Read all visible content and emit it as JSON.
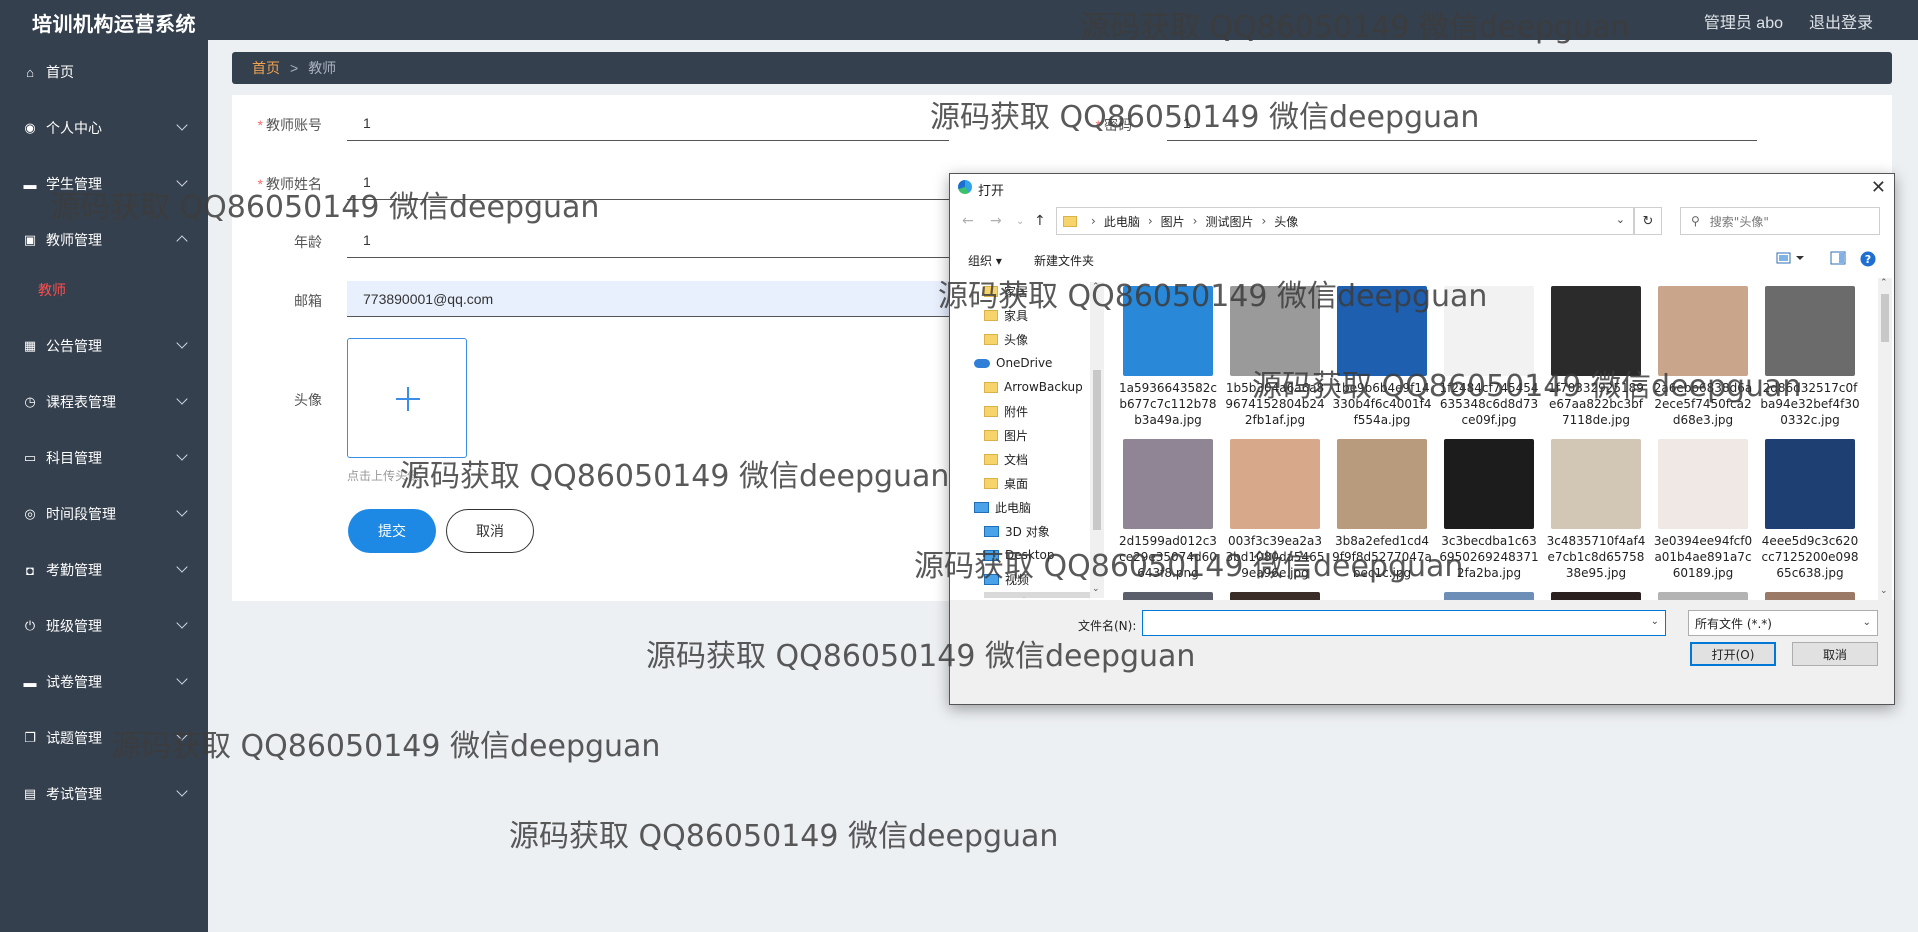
{
  "app": {
    "title": "培训机构运营系统",
    "user": "管理员 abo",
    "logout": "退出登录"
  },
  "sidebar": {
    "items": [
      {
        "label": "首页",
        "icon": "home-icon"
      },
      {
        "label": "个人中心",
        "icon": "user-icon"
      },
      {
        "label": "学生管理",
        "icon": "chat-icon"
      },
      {
        "label": "教师管理",
        "icon": "chart-icon",
        "expanded": true
      },
      {
        "label": "公告管理",
        "icon": "grid-icon"
      },
      {
        "label": "课程表管理",
        "icon": "clock-icon"
      },
      {
        "label": "科目管理",
        "icon": "monitor-icon"
      },
      {
        "label": "时间段管理",
        "icon": "target-icon"
      },
      {
        "label": "考勤管理",
        "icon": "message-icon"
      },
      {
        "label": "班级管理",
        "icon": "power-icon"
      },
      {
        "label": "试卷管理",
        "icon": "chat-icon"
      },
      {
        "label": "试题管理",
        "icon": "copy-icon"
      },
      {
        "label": "考试管理",
        "icon": "card-icon"
      }
    ],
    "submenu": {
      "label": "教师",
      "color": "#ff4d4f"
    }
  },
  "breadcrumb": {
    "home": "首页",
    "separator": ">",
    "current": "教师"
  },
  "form": {
    "account_label": "教师账号",
    "account_value": "1",
    "password_label": "密码",
    "password_value": "1",
    "name_label": "教师姓名",
    "name_value": "1",
    "age_label": "年龄",
    "age_value": "1",
    "email_label": "邮箱",
    "email_value": "773890001@qq.com",
    "avatar_label": "头像",
    "upload_hint": "点击上传头像",
    "submit": "提交",
    "cancel": "取消"
  },
  "watermark": "源码获取 QQ86050149 微信deepguan",
  "dialog": {
    "title": "打开",
    "path": [
      "此电脑",
      "图片",
      "测试图片",
      "头像"
    ],
    "search_placeholder": "搜索\"头像\"",
    "organize": "组织 ▾",
    "new_folder": "新建文件夹",
    "nav": [
      {
        "label": "家居",
        "type": "folder"
      },
      {
        "label": "家具",
        "type": "folder"
      },
      {
        "label": "头像",
        "type": "folder"
      },
      {
        "label": "OneDrive",
        "type": "cloud"
      },
      {
        "label": "ArrowBackup",
        "type": "folder"
      },
      {
        "label": "附件",
        "type": "folder"
      },
      {
        "label": "图片",
        "type": "folder"
      },
      {
        "label": "文档",
        "type": "folder"
      },
      {
        "label": "桌面",
        "type": "folder"
      },
      {
        "label": "此电脑",
        "type": "pc"
      },
      {
        "label": "3D 对象",
        "type": "pc"
      },
      {
        "label": "Desktop",
        "type": "pc"
      },
      {
        "label": "视频",
        "type": "pc"
      },
      {
        "label": "图片",
        "type": "pc",
        "selected": true
      }
    ],
    "files": [
      {
        "name": "1a5936643582cb677c7c112b78b3a49a.jpg",
        "color": "#2a88d8"
      },
      {
        "name": "1b5b304a6a6a89674152804b242fb1af.jpg",
        "color": "#9a9a9a"
      },
      {
        "name": "1be9b6b4e9f14330b4f6c4001f4f554a.jpg",
        "color": "#1f5fb0"
      },
      {
        "name": "1f2484cf745454635348c6d8d73ce09f.jpg",
        "color": "#f2f2f2"
      },
      {
        "name": "1f70332925189e67aa822bc3bf7118de.jpg",
        "color": "#2b2b2b"
      },
      {
        "name": "2a6ebb6838d6a2ece5f7450fca2d68e3.jpg",
        "color": "#c9a58c"
      },
      {
        "name": "2d86d32517c0fba94e32bef4f300332c.jpg",
        "color": "#6b6b6b"
      },
      {
        "name": "2d1599ad012c3ce29e35074d60643f8.png",
        "color": "#8f8595"
      },
      {
        "name": "003f3c39ea2a33bd1080da54659ea96e.jpg",
        "color": "#d7a98a"
      },
      {
        "name": "3b8a2efed1cd49f9f8d5277047abec1c.jpg",
        "color": "#b89a7d"
      },
      {
        "name": "3c3becdba1c636950269248371 2fa2ba.jpg",
        "color": "#1c1c1c"
      },
      {
        "name": "3c4835710f4af4e7cb1c8d6575838e95.jpg",
        "color": "#d2c6b5"
      },
      {
        "name": "3e0394ee94fcf0a01b4ae891a7c60189.jpg",
        "color": "#efe8e4"
      },
      {
        "name": "4eee5d9c3c620cc7125200e09865c638.jpg",
        "color": "#1d3f72"
      },
      {
        "name": "",
        "color": "#5a5f6b"
      },
      {
        "name": "",
        "color": "#3a2c26"
      },
      {
        "name": "",
        "color": "#ffffff"
      },
      {
        "name": "",
        "color": "#6d8fb7"
      },
      {
        "name": "",
        "color": "#2a2020"
      },
      {
        "name": "",
        "color": "#b3b3b3"
      },
      {
        "name": "",
        "color": "#9a7a66"
      }
    ],
    "filename_label": "文件名(N):",
    "filename_value": "",
    "filetype": "所有文件 (*.*)",
    "open": "打开(O)",
    "cancel": "取消"
  }
}
